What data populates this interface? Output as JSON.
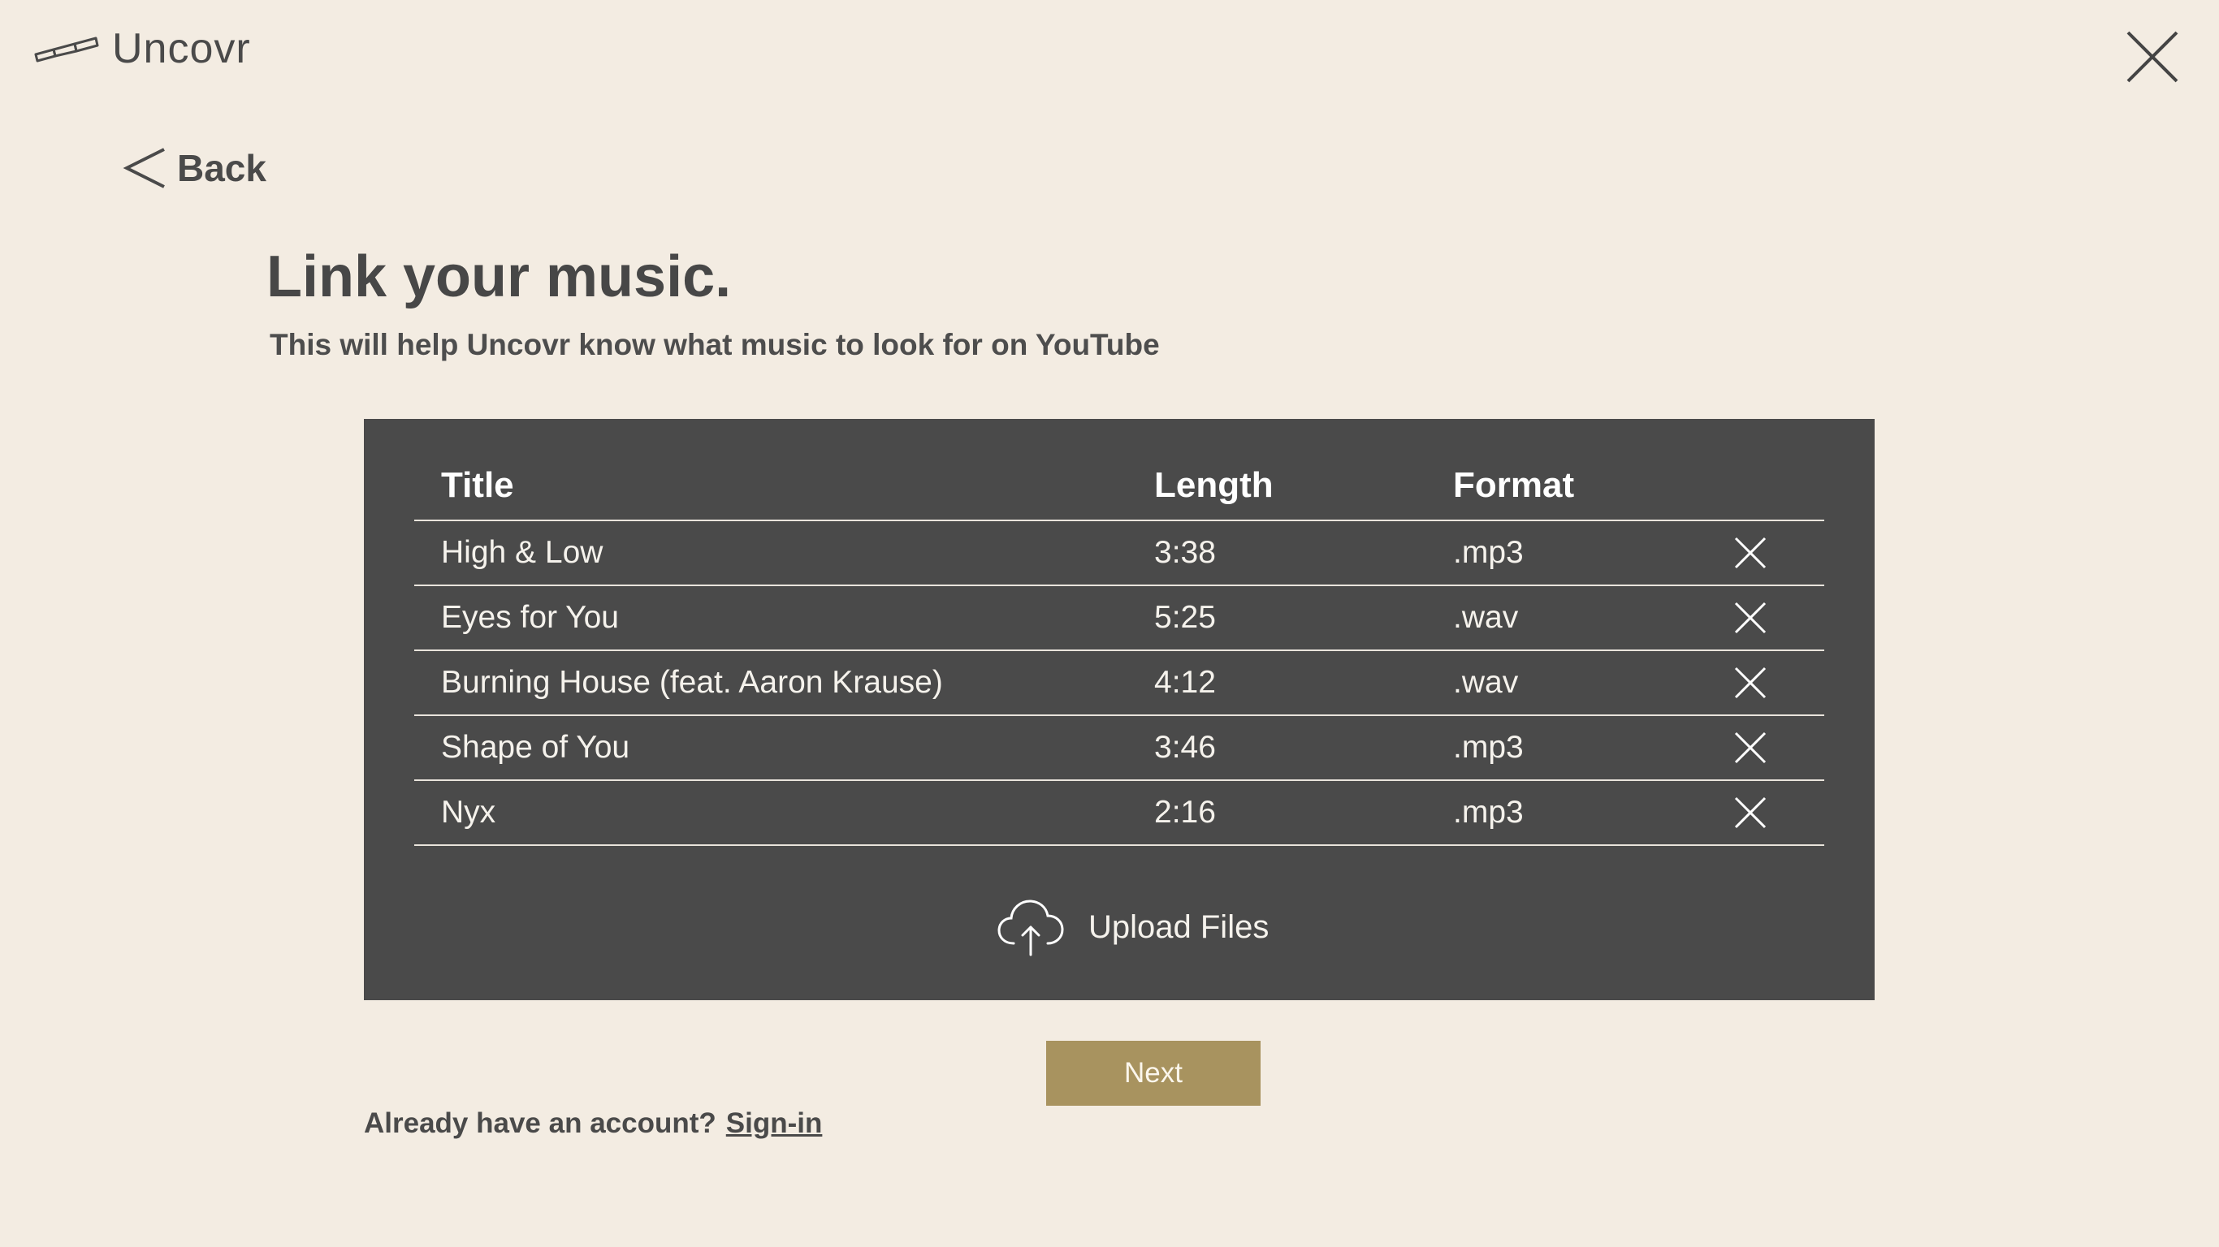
{
  "app": {
    "name": "Uncovr"
  },
  "nav": {
    "back_label": "Back"
  },
  "header": {
    "title": "Link your music.",
    "subtitle": "This will help Uncovr know what music to look for on YouTube"
  },
  "table": {
    "columns": [
      "Title",
      "Length",
      "Format"
    ],
    "rows": [
      {
        "title": "High & Low",
        "length": "3:38",
        "format": ".mp3"
      },
      {
        "title": "Eyes for You",
        "length": "5:25",
        "format": ".wav"
      },
      {
        "title": "Burning House (feat. Aaron Krause)",
        "length": "4:12",
        "format": ".wav"
      },
      {
        "title": "Shape of You",
        "length": "3:46",
        "format": ".mp3"
      },
      {
        "title": "Nyx",
        "length": "2:16",
        "format": ".mp3"
      }
    ]
  },
  "upload": {
    "label": "Upload Files",
    "icon": "cloud-upload-icon"
  },
  "actions": {
    "next_label": "Next"
  },
  "footer": {
    "account_prompt": "Already have an account?",
    "signin_label": "Sign-in"
  },
  "colors": {
    "background": "#f3ece2",
    "panel": "#4a4a4a",
    "accent": "#a8935f",
    "text": "#474747"
  }
}
